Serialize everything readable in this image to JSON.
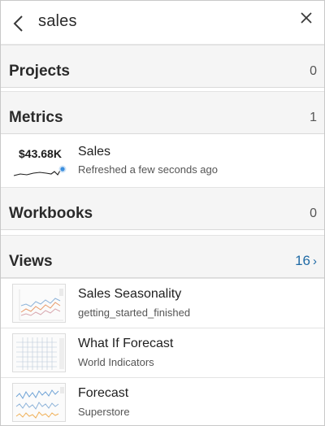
{
  "search": {
    "query": "sales"
  },
  "sections": {
    "projects": {
      "title": "Projects",
      "count": "0"
    },
    "metrics": {
      "title": "Metrics",
      "count": "1"
    },
    "workbooks": {
      "title": "Workbooks",
      "count": "0"
    },
    "views": {
      "title": "Views",
      "count": "16"
    }
  },
  "metric": {
    "value": "$43.68K",
    "title": "Sales",
    "subtitle": "Refreshed a few seconds ago"
  },
  "views": [
    {
      "title": "Sales Seasonality",
      "subtitle": "getting_started_finished"
    },
    {
      "title": "What If Forecast",
      "subtitle": "World Indicators"
    },
    {
      "title": "Forecast",
      "subtitle": "Superstore"
    }
  ],
  "colors": {
    "accent": "#1f6aa5",
    "sparkline": "#1c1c1c",
    "sparkline_dot": "#3b8ede",
    "header_bg": "#f5f5f5"
  }
}
